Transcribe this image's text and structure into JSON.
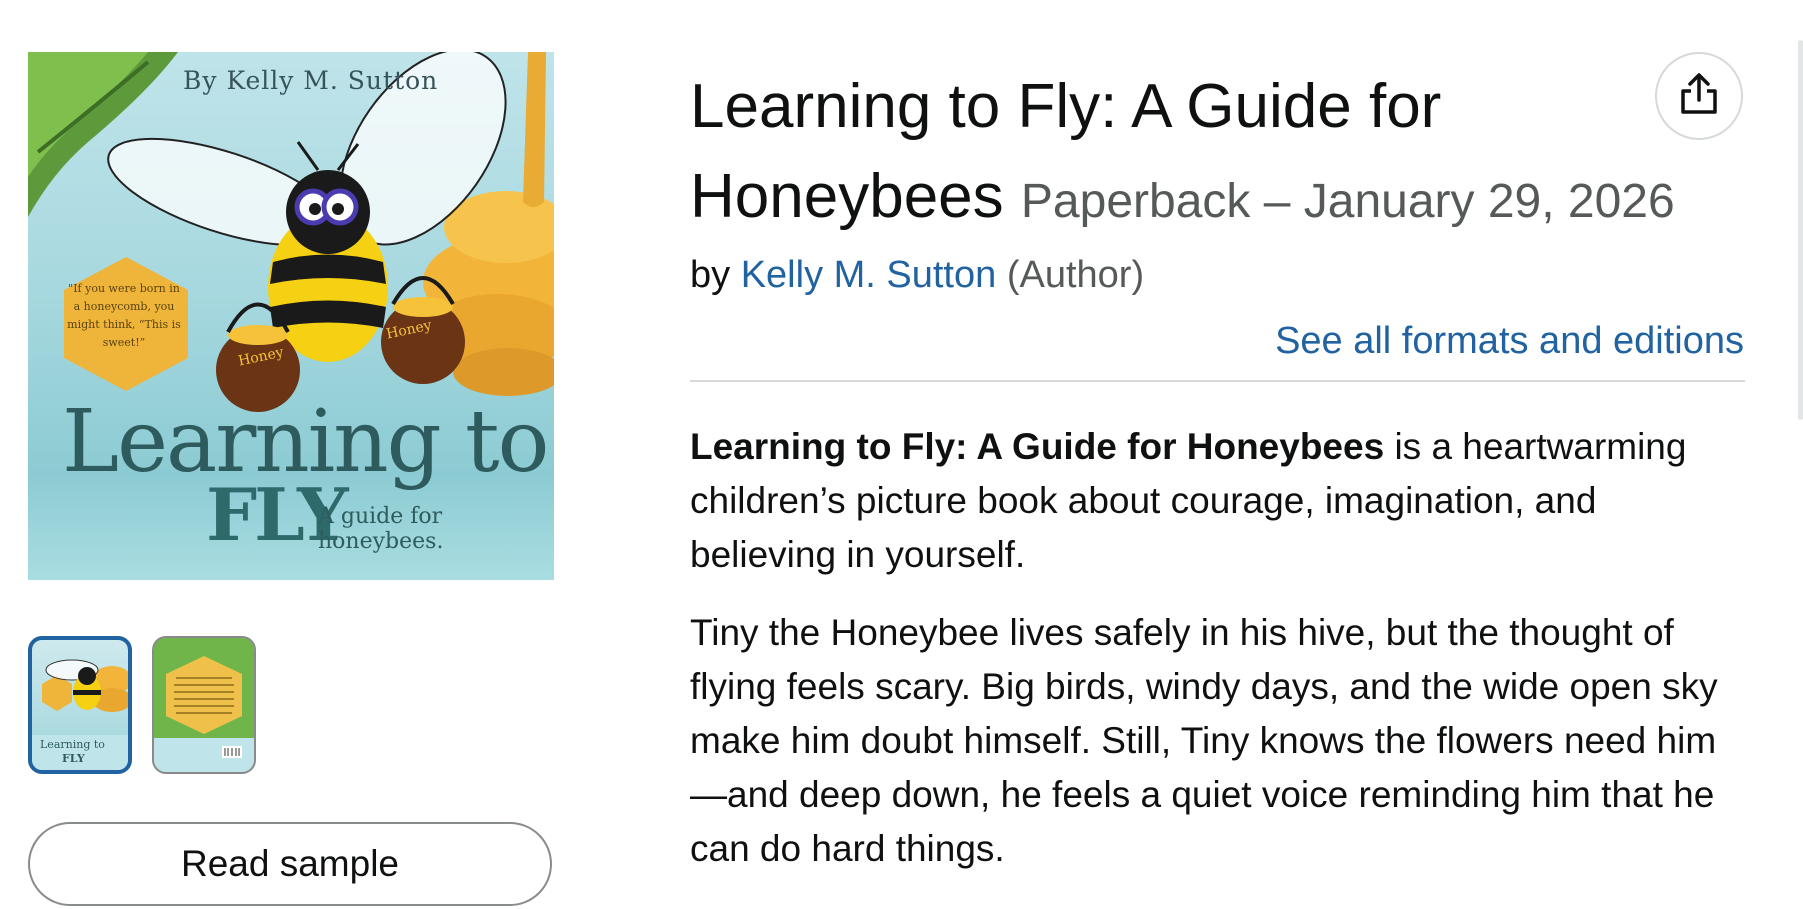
{
  "cover": {
    "byline": "By Kelly M. Sutton",
    "quote": "\"If you were born in a honeycomb, you might think, “This is sweet!”",
    "pot_label_left": "Honey",
    "pot_label_right": "Honey",
    "title_line1": "Learning to",
    "title_line2": "FLY",
    "subtitle": "A guide for honeybees."
  },
  "thumbnails": [
    {
      "name": "front cover",
      "selected": true
    },
    {
      "name": "back cover",
      "selected": false
    }
  ],
  "read_sample_label": "Read sample",
  "product": {
    "title_line1": "Learning to Fly: A Guide for",
    "title_line2": "Honeybees",
    "format": "Paperback – January 29, 2026",
    "by_label": "by",
    "author": "Kelly M. Sutton",
    "author_role": "(Author)",
    "formats_link": "See all formats and editions"
  },
  "description": {
    "p1_bold": "Learning to Fly: A Guide for Honeybees",
    "p1_rest": " is a heartwarming children’s picture book about courage, imagination, and believing in yourself.",
    "p2": "Tiny the Honeybee lives safely in his hive, but the thought of flying feels scary. Big birds, windy days, and the wide open sky make him doubt himself. Still, Tiny knows the flowers need him—and deep down, he feels a quiet voice reminding him that he can do hard things."
  },
  "icons": {
    "share": "share-icon"
  },
  "colors": {
    "link": "#2162a1",
    "text": "#0f1111",
    "muted": "#565959",
    "selected_border": "#2162a1"
  }
}
